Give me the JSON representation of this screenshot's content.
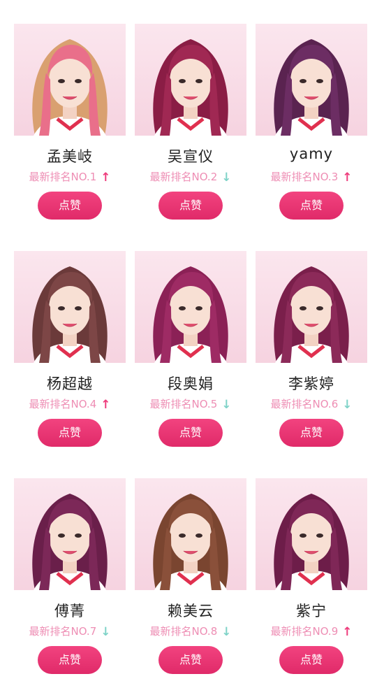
{
  "colors": {
    "name_text": "#222222",
    "rank_text": "#ee8eb4",
    "arrow_up": "#ee3c7c",
    "arrow_down": "#7fd3c8",
    "button_bg": "#e8306f",
    "photo_bg": "#f8dbe6"
  },
  "contestants": [
    {
      "name": "孟美岐",
      "rank_text": "最新排名NO.1",
      "trend": "up",
      "trend_icon": "↑",
      "like_label": "点赞",
      "hair_color": "#d9a070",
      "hair_accent": "#e96f8a"
    },
    {
      "name": "吴宣仪",
      "rank_text": "最新排名NO.2",
      "trend": "down",
      "trend_icon": "↓",
      "like_label": "点赞",
      "hair_color": "#8a1d45",
      "hair_accent": "#a02853"
    },
    {
      "name": "yamy",
      "rank_text": "最新排名NO.3",
      "trend": "up",
      "trend_icon": "↑",
      "like_label": "点赞",
      "hair_color": "#5a2350",
      "hair_accent": "#6c2d63"
    },
    {
      "name": "杨超越",
      "rank_text": "最新排名NO.4",
      "trend": "up",
      "trend_icon": "↑",
      "like_label": "点赞",
      "hair_color": "#6b3a3a",
      "hair_accent": "#7d4646"
    },
    {
      "name": "段奥娟",
      "rank_text": "最新排名NO.5",
      "trend": "down",
      "trend_icon": "↓",
      "like_label": "点赞",
      "hair_color": "#8b2156",
      "hair_accent": "#9e2b64"
    },
    {
      "name": "李紫婷",
      "rank_text": "最新排名NO.6",
      "trend": "down",
      "trend_icon": "↓",
      "like_label": "点赞",
      "hair_color": "#7a1f4b",
      "hair_accent": "#8c2a59"
    },
    {
      "name": "傅菁",
      "rank_text": "最新排名NO.7",
      "trend": "down",
      "trend_icon": "↓",
      "like_label": "点赞",
      "hair_color": "#6a1f4a",
      "hair_accent": "#7c2858"
    },
    {
      "name": "赖美云",
      "rank_text": "最新排名NO.8",
      "trend": "down",
      "trend_icon": "↓",
      "like_label": "点赞",
      "hair_color": "#7a4530",
      "hair_accent": "#8a503a"
    },
    {
      "name": "紫宁",
      "rank_text": "最新排名NO.9",
      "trend": "up",
      "trend_icon": "↑",
      "like_label": "点赞",
      "hair_color": "#6d1d49",
      "hair_accent": "#7f2757"
    }
  ]
}
